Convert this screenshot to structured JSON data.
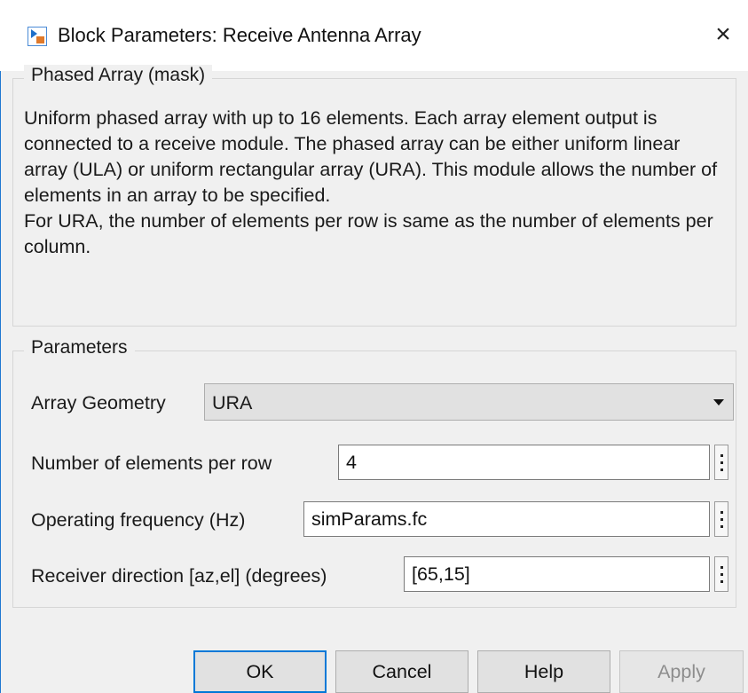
{
  "window": {
    "title": "Block Parameters: Receive Antenna Array",
    "close_glyph": "×",
    "accent_color": "#0078d7",
    "icon": "simulink-block-icon"
  },
  "mask_group": {
    "legend": "Phased Array (mask)",
    "description_lines": [
      "Uniform phased array with up to 16 elements. Each array element output is connected to a receive module. The phased array can be either uniform linear array (ULA) or uniform rectangular array (URA). This module allows the number of elements in an array to be specified.",
      "For URA, the number of elements per row is same as the number of elements per column."
    ]
  },
  "parameters_group": {
    "legend": "Parameters",
    "array_geometry": {
      "label": "Array Geometry",
      "value": "URA"
    },
    "elements_per_row": {
      "label": "Number of elements per row",
      "value": "4"
    },
    "operating_frequency": {
      "label": "Operating frequency (Hz)",
      "value": "simParams.fc"
    },
    "receiver_direction": {
      "label": "Receiver direction [az,el] (degrees)",
      "value": "[65,15]"
    }
  },
  "buttons": {
    "ok": "OK",
    "cancel": "Cancel",
    "help": "Help",
    "apply": "Apply"
  }
}
